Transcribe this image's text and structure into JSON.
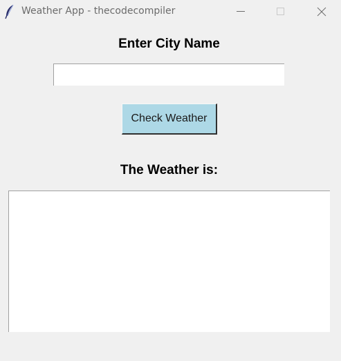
{
  "window": {
    "title": "Weather App - thecodecompiler",
    "icon": "feather-icon",
    "controls": [
      "minimize-icon",
      "maximize-icon",
      "close-icon"
    ]
  },
  "labels": {
    "city_heading": "Enter City Name",
    "result_heading": "The Weather is:"
  },
  "city_input": {
    "value": "",
    "placeholder": ""
  },
  "check_button": {
    "label": "Check Weather",
    "background": "#add8e6"
  },
  "result": {
    "text": ""
  }
}
